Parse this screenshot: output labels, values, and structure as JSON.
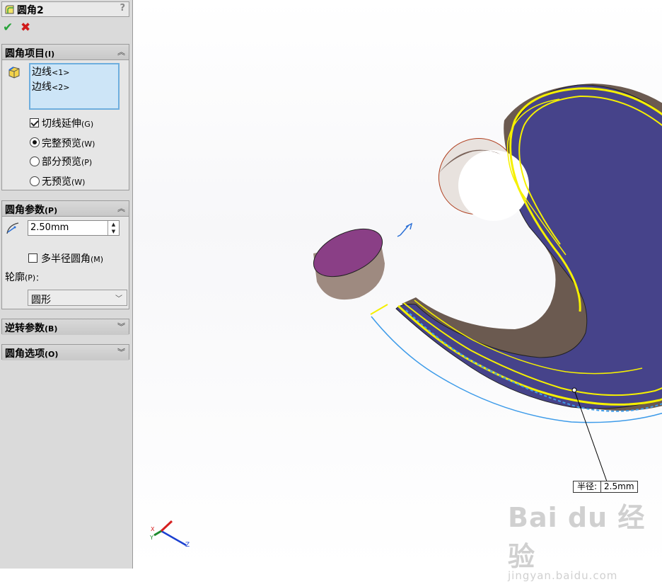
{
  "panel": {
    "title": "圆角2",
    "help": "?",
    "ok_glyph": "✔",
    "cancel_glyph": "✖"
  },
  "fillet_items": {
    "label": "圆角项目",
    "hotkey": "(I)",
    "edges": [
      {
        "name": "边线",
        "index": "<1>"
      },
      {
        "name": "边线",
        "index": "<2>"
      }
    ],
    "tangent_propagation": {
      "label": "切线延伸",
      "hotkey": "(G)",
      "checked": true
    },
    "preview_options": [
      {
        "label": "完整预览",
        "hotkey": "(W)",
        "selected": true
      },
      {
        "label": "部分预览",
        "hotkey": "(P)",
        "selected": false
      },
      {
        "label": "无预览",
        "hotkey": "(W)",
        "selected": false
      }
    ]
  },
  "fillet_params": {
    "label": "圆角参数",
    "hotkey": "(P)",
    "radius": "2.50mm",
    "multi_radius": {
      "label": "多半径圆角",
      "hotkey": "(M)",
      "checked": false
    },
    "profile_label": "轮廓",
    "profile_hotkey": "(P)：",
    "profile_value": "圆形"
  },
  "collapsed_sections": [
    {
      "label": "逆转参数",
      "hotkey": "(B)"
    },
    {
      "label": "圆角选项",
      "hotkey": "(O)"
    }
  ],
  "viewport": {
    "radius_callout_key": "半径:",
    "radius_callout_value": "2.5mm",
    "triad": {
      "x": "X",
      "y": "Y",
      "z": "Z"
    }
  },
  "watermark": {
    "brand": "Bai du 经验",
    "url": "jingyan.baidu.com"
  },
  "colors": {
    "face": "#46438a",
    "boss": "#8a3f86",
    "preview_edge": "#f5f000",
    "selection_blue": "#3d9be9"
  }
}
